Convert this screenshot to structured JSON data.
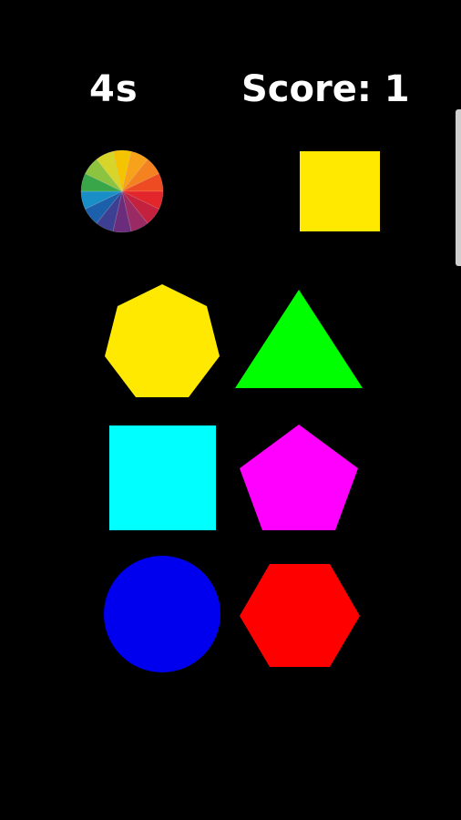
{
  "hud": {
    "timer": "4s",
    "score_label": "Score:",
    "score_value": "1"
  },
  "target": {
    "icon": "color-wheel-icon",
    "shape": "square",
    "color": "#ffe900"
  },
  "colors": {
    "background": "#000000",
    "yellow": "#ffe900",
    "green": "#00ff00",
    "cyan": "#00ffff",
    "magenta": "#ff00ff",
    "blue": "#0000ee",
    "red": "#ff0000"
  },
  "options": [
    {
      "shape": "heptagon",
      "color": "#ffe900",
      "icon": "yellow-heptagon-icon"
    },
    {
      "shape": "triangle",
      "color": "#00ff00",
      "icon": "green-triangle-icon"
    },
    {
      "shape": "square",
      "color": "#00ffff",
      "icon": "cyan-square-icon"
    },
    {
      "shape": "pentagon",
      "color": "#ff00ff",
      "icon": "magenta-pentagon-icon"
    },
    {
      "shape": "circle",
      "color": "#0000ee",
      "icon": "blue-circle-icon"
    },
    {
      "shape": "hexagon",
      "color": "#ff0000",
      "icon": "red-hexagon-icon"
    }
  ]
}
